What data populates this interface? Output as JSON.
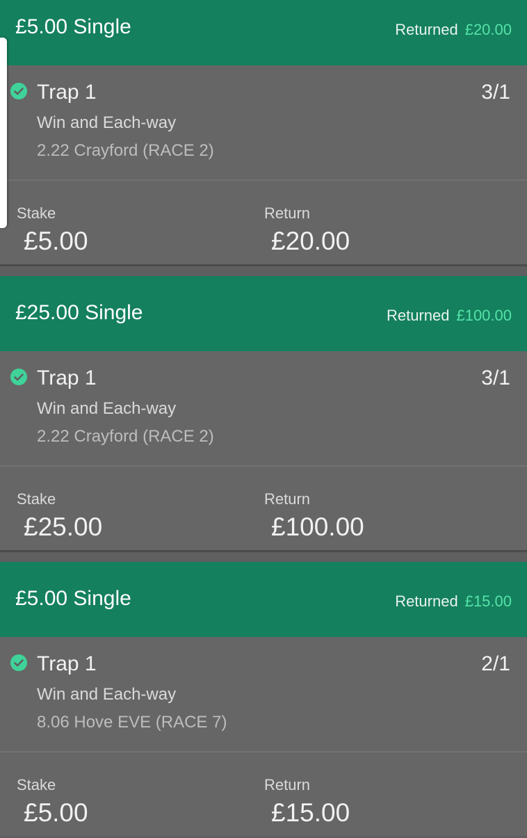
{
  "colors": {
    "header_bg": "#14805e",
    "body_bg": "#666666",
    "returned_value": "#55e3a8",
    "check": "#3fd39a"
  },
  "bets": [
    {
      "title": "£5.00 Single",
      "returned_label": "Returned",
      "returned_value": "£20.00",
      "selection": "Trap 1",
      "odds": "3/1",
      "market": "Win and Each-way",
      "event": "2.22 Crayford (RACE 2)",
      "stake_label": "Stake",
      "stake_value": "£5.00",
      "return_label": "Return",
      "return_value": "£20.00"
    },
    {
      "title": "£25.00 Single",
      "returned_label": "Returned",
      "returned_value": "£100.00",
      "selection": "Trap 1",
      "odds": "3/1",
      "market": "Win and Each-way",
      "event": "2.22 Crayford (RACE 2)",
      "stake_label": "Stake",
      "stake_value": "£25.00",
      "return_label": "Return",
      "return_value": "£100.00"
    },
    {
      "title": "£5.00 Single",
      "returned_label": "Returned",
      "returned_value": "£15.00",
      "selection": "Trap 1",
      "odds": "2/1",
      "market": "Win and Each-way",
      "event": "8.06 Hove EVE (RACE 7)",
      "stake_label": "Stake",
      "stake_value": "£5.00",
      "return_label": "Return",
      "return_value": "£15.00"
    }
  ]
}
